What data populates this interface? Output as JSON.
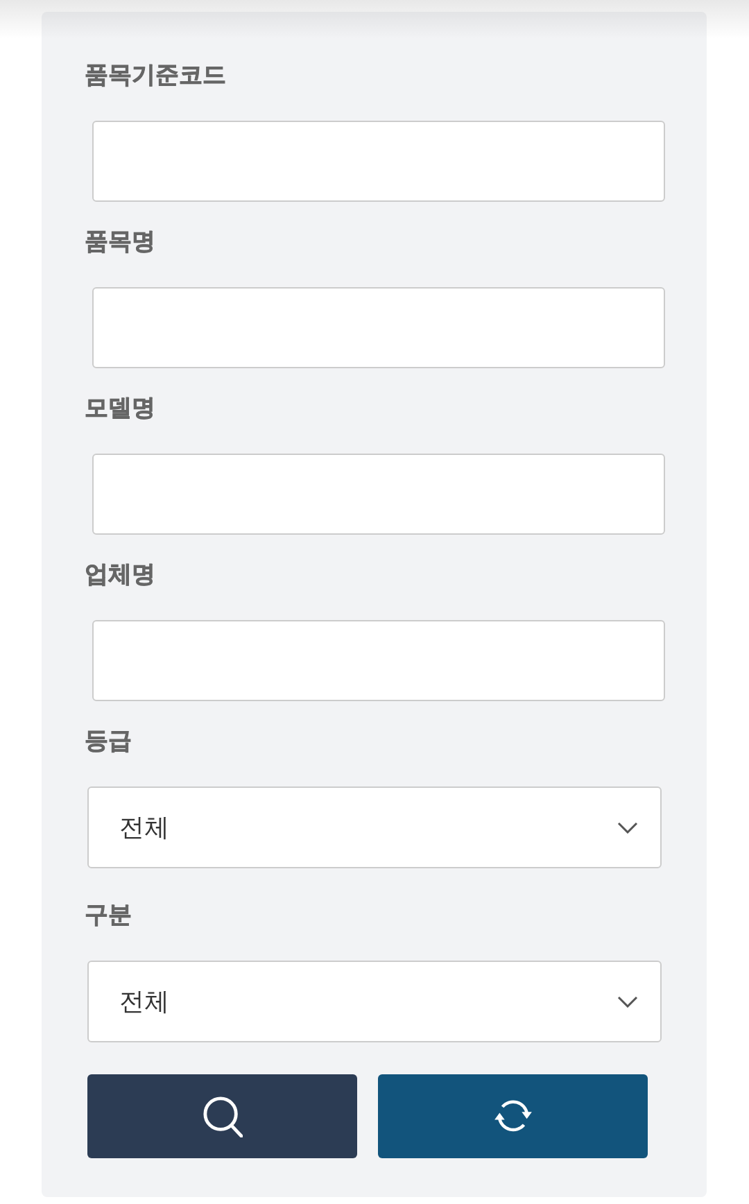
{
  "form": {
    "fields": [
      {
        "kind": "text",
        "label": "품목기준코드"
      },
      {
        "kind": "text",
        "label": "품목명"
      },
      {
        "kind": "text",
        "label": "모델명"
      },
      {
        "kind": "text",
        "label": "업체명"
      },
      {
        "kind": "select",
        "label": "등급",
        "value": "전체"
      },
      {
        "kind": "select",
        "label": "구분",
        "value": "전체"
      }
    ],
    "buttons": [
      {
        "kind": "search"
      },
      {
        "kind": "refresh"
      }
    ]
  }
}
